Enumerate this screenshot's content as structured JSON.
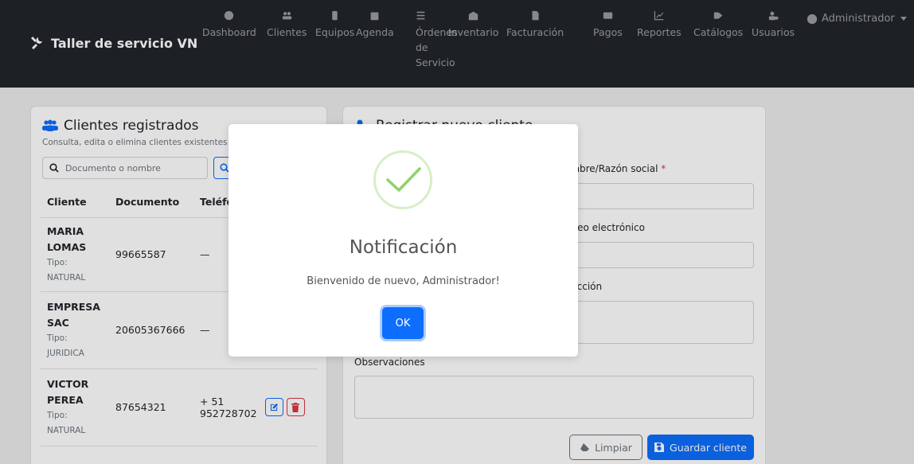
{
  "navbar": {
    "brand": "Taller de servicio VN",
    "items": [
      {
        "label": "Dashboard",
        "icon": "dashboard-icon"
      },
      {
        "label": "Clientes",
        "icon": "users-icon"
      },
      {
        "label": "Equipos",
        "icon": "mobile-icon"
      },
      {
        "label": "Agenda",
        "icon": "calendar-icon"
      },
      {
        "label": "Órdenes de Servicio",
        "icon": "list-icon"
      },
      {
        "label": "Inventario",
        "icon": "warehouse-icon"
      },
      {
        "label": "Facturación",
        "icon": "invoice-icon"
      },
      {
        "label": "Pagos",
        "icon": "card-icon"
      },
      {
        "label": "Reportes",
        "icon": "chart-icon"
      },
      {
        "label": "Catálogos",
        "icon": "tag-icon"
      },
      {
        "label": "Usuarios",
        "icon": "user-cog-icon"
      }
    ],
    "user": "Administrador"
  },
  "clients_panel": {
    "title": "Clientes registrados",
    "subtitle": "Consulta, edita o elimina clientes existentes",
    "search_placeholder": "Documento o nombre",
    "columns": [
      "Cliente",
      "Documento",
      "Teléfono"
    ],
    "rows": [
      {
        "name_line1": "MARIA",
        "name_line2": "LOMAS",
        "tipo_label": "Tipo:",
        "tipo": "NATURAL",
        "documento": "99665587",
        "telefono_line1": "—",
        "telefono_line2": ""
      },
      {
        "name_line1": "EMPRESA",
        "name_line2": "SAC",
        "tipo_label": "Tipo:",
        "tipo": "JURIDICA",
        "documento": "20605367666",
        "telefono_line1": "—",
        "telefono_line2": ""
      },
      {
        "name_line1": "VICTOR",
        "name_line2": "PEREA",
        "tipo_label": "Tipo:",
        "tipo": "NATURAL",
        "documento": "87654321",
        "telefono_line1": "+ 51",
        "telefono_line2": "952728702"
      }
    ]
  },
  "register_form": {
    "title": "Registrar nuevo cliente",
    "field_name_label": "Nombre/Razón social",
    "required_mark": "*",
    "field_email_label": "Correo electrónico",
    "field_address_label": "Dirección",
    "field_notes_label": "Observaciones",
    "clear_button": "Limpiar",
    "save_button": "Guardar cliente"
  },
  "modal": {
    "title": "Notificación",
    "message": "Bienvenido de nuevo, Administrador!",
    "ok_button": "OK",
    "icon": "success-check-icon"
  },
  "colors": {
    "navbar": "#212529",
    "primary": "#0d6efd",
    "danger": "#dc3545",
    "success_ring": "#d7efc6",
    "success_check": "#8fd16a"
  }
}
